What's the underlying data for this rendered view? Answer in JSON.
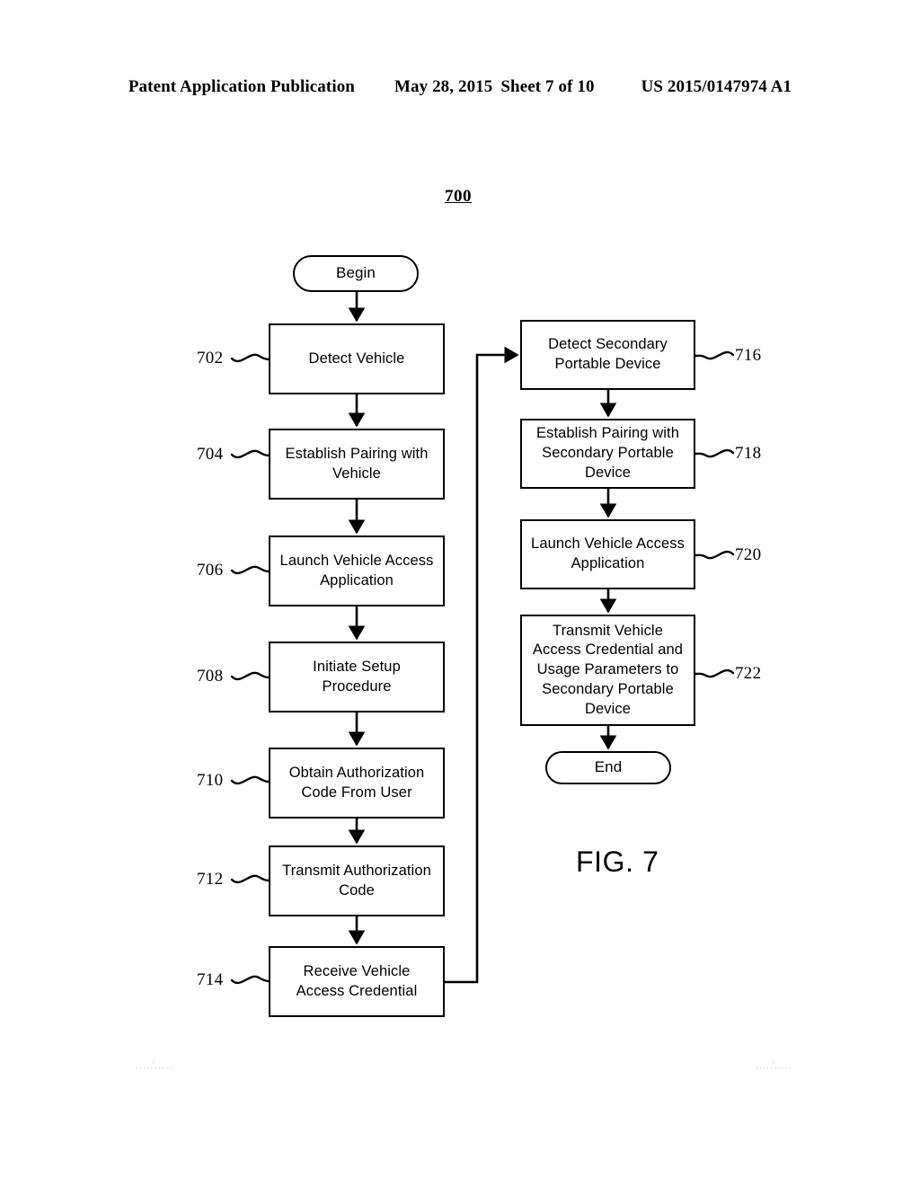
{
  "header": {
    "publication": "Patent Application Publication",
    "date": "May 28, 2015",
    "sheet": "Sheet 7 of 10",
    "document_number": "US 2015/0147974 A1"
  },
  "figure": {
    "flow_ref": "700",
    "label": "FIG. 7"
  },
  "flow": {
    "terminals": {
      "begin": "Begin",
      "end": "End"
    },
    "left_column": [
      {
        "ref": "702",
        "text": "Detect Vehicle"
      },
      {
        "ref": "704",
        "text": "Establish Pairing with Vehicle"
      },
      {
        "ref": "706",
        "text": "Launch Vehicle Access Application"
      },
      {
        "ref": "708",
        "text": "Initiate Setup Procedure"
      },
      {
        "ref": "710",
        "text": "Obtain Authorization Code From User"
      },
      {
        "ref": "712",
        "text": "Transmit Authorization Code"
      },
      {
        "ref": "714",
        "text": "Receive Vehicle Access Credential"
      }
    ],
    "right_column": [
      {
        "ref": "716",
        "text": "Detect Secondary Portable Device"
      },
      {
        "ref": "718",
        "text": "Establish Pairing with Secondary Portable Device"
      },
      {
        "ref": "720",
        "text": "Launch Vehicle Access Application"
      },
      {
        "ref": "722",
        "text": "Transmit Vehicle Access Credential and Usage Parameters to Secondary Portable Device"
      }
    ]
  },
  "registration_marks": {
    "left": ":",
    "right": ":"
  },
  "colors": {
    "ink": "#000000",
    "page": "#ffffff",
    "reg_mark": "#b9b9b9"
  }
}
